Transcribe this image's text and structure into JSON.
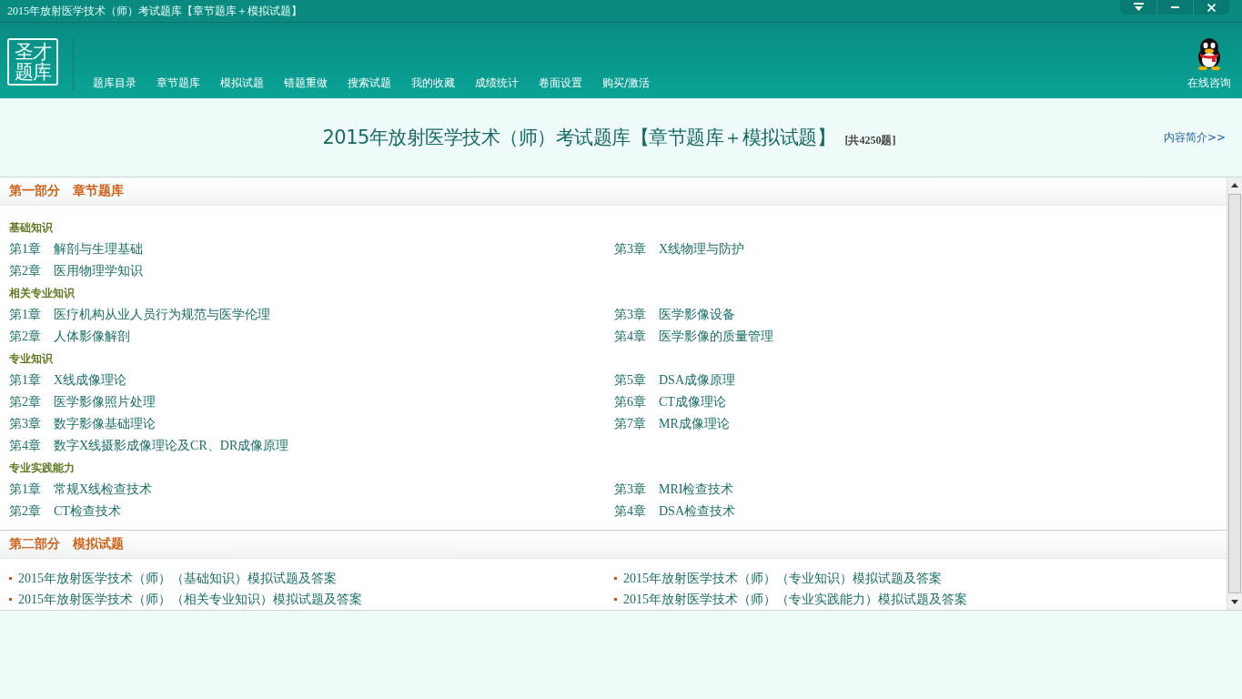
{
  "window": {
    "title": "2015年放射医学技术（师）考试题库【章节题库＋模拟试题】"
  },
  "logo": {
    "text": "圣才题库"
  },
  "nav": [
    {
      "label": "题库目录"
    },
    {
      "label": "章节题库"
    },
    {
      "label": "模拟试题"
    },
    {
      "label": "错题重做"
    },
    {
      "label": "搜索试题"
    },
    {
      "label": "我的收藏"
    },
    {
      "label": "成绩统计"
    },
    {
      "label": "卷面设置"
    },
    {
      "label": "购买/激活"
    }
  ],
  "consult": {
    "label": "在线咨询"
  },
  "heading": {
    "title": "2015年放射医学技术（师）考试题库【章节题库＋模拟试题】",
    "count": "[共4250题]",
    "intro_link": "内容简介>>"
  },
  "sections": [
    {
      "kind": "chapters",
      "title": "第一部分　章节题库",
      "groups": [
        {
          "title": "基础知识",
          "left": [
            {
              "number": "第1章",
              "title": "解剖与生理基础"
            },
            {
              "number": "第2章",
              "title": "医用物理学知识"
            }
          ],
          "right": [
            {
              "number": "第3章",
              "title": "X线物理与防护"
            }
          ]
        },
        {
          "title": "相关专业知识",
          "left": [
            {
              "number": "第1章",
              "title": "医疗机构从业人员行为规范与医学伦理"
            },
            {
              "number": "第2章",
              "title": "人体影像解剖"
            }
          ],
          "right": [
            {
              "number": "第3章",
              "title": "医学影像设备"
            },
            {
              "number": "第4章",
              "title": "医学影像的质量管理"
            }
          ]
        },
        {
          "title": "专业知识",
          "left": [
            {
              "number": "第1章",
              "title": "X线成像理论"
            },
            {
              "number": "第2章",
              "title": "医学影像照片处理"
            },
            {
              "number": "第3章",
              "title": "数字影像基础理论"
            },
            {
              "number": "第4章",
              "title": "数字X线摄影成像理论及CR、DR成像原理"
            }
          ],
          "right": [
            {
              "number": "第5章",
              "title": "DSA成像原理"
            },
            {
              "number": "第6章",
              "title": "CT成像理论"
            },
            {
              "number": "第7章",
              "title": "MR成像理论"
            }
          ]
        },
        {
          "title": "专业实践能力",
          "left": [
            {
              "number": "第1章",
              "title": "常规X线检查技术"
            },
            {
              "number": "第2章",
              "title": "CT检查技术"
            }
          ],
          "right": [
            {
              "number": "第3章",
              "title": "MRI检查技术"
            },
            {
              "number": "第4章",
              "title": "DSA检查技术"
            }
          ]
        }
      ]
    },
    {
      "kind": "tests",
      "title": "第二部分　模拟试题",
      "left": [
        "2015年放射医学技术（师）（基础知识）模拟试题及答案",
        "2015年放射医学技术（师）（相关专业知识）模拟试题及答案"
      ],
      "right": [
        "2015年放射医学技术（师）（专业知识）模拟试题及答案",
        "2015年放射医学技术（师）（专业实践能力）模拟试题及答案"
      ]
    }
  ]
}
